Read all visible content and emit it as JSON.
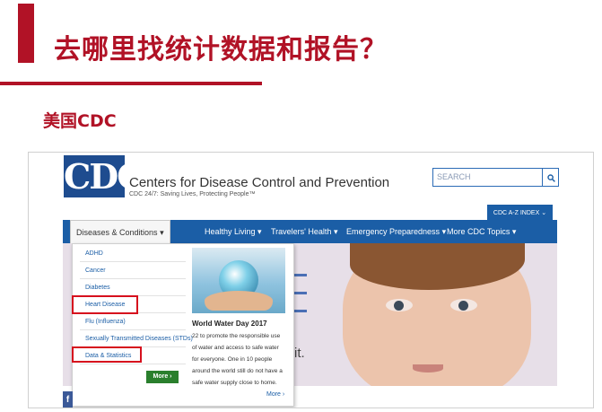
{
  "slide": {
    "title": "去哪里找统计数据和报告？",
    "section": "美国CDC",
    "accent_color": "#b11226"
  },
  "cdc": {
    "logo_text": "CDC",
    "org_name": "Centers for Disease Control and Prevention",
    "tagline": "CDC 24/7: Saving Lives, Protecting People™",
    "search_placeholder": "SEARCH",
    "search_icon": "search-icon",
    "az_index": "CDC A-Z INDEX",
    "brand_color": "#1b5ea6"
  },
  "nav": {
    "items": [
      "Diseases & Conditions",
      "Healthy Living",
      "Travelers' Health",
      "Emergency Preparedness",
      "More CDC Topics"
    ]
  },
  "dropdown": {
    "items": [
      "ADHD",
      "Cancer",
      "Diabetes",
      "Heart Disease",
      "Flu (Influenza)",
      "Sexually Transmitted Diseases (STDs)",
      "Data & Statistics"
    ],
    "more_button": "More",
    "highlight_color": "#d6101d",
    "highlighted": [
      "Heart Disease",
      "Data & Statistics"
    ]
  },
  "feature": {
    "title": "World Water Day 2017",
    "lines": [
      "22 to promote the responsible use",
      "of water and access to safe water",
      "for everyone. One in 10 people",
      "around the world still do not have a",
      "safe water supply close to home."
    ],
    "more_link": "More"
  },
  "hero": {
    "fragment_text": "it."
  },
  "social": {
    "facebook_letter": "f"
  }
}
